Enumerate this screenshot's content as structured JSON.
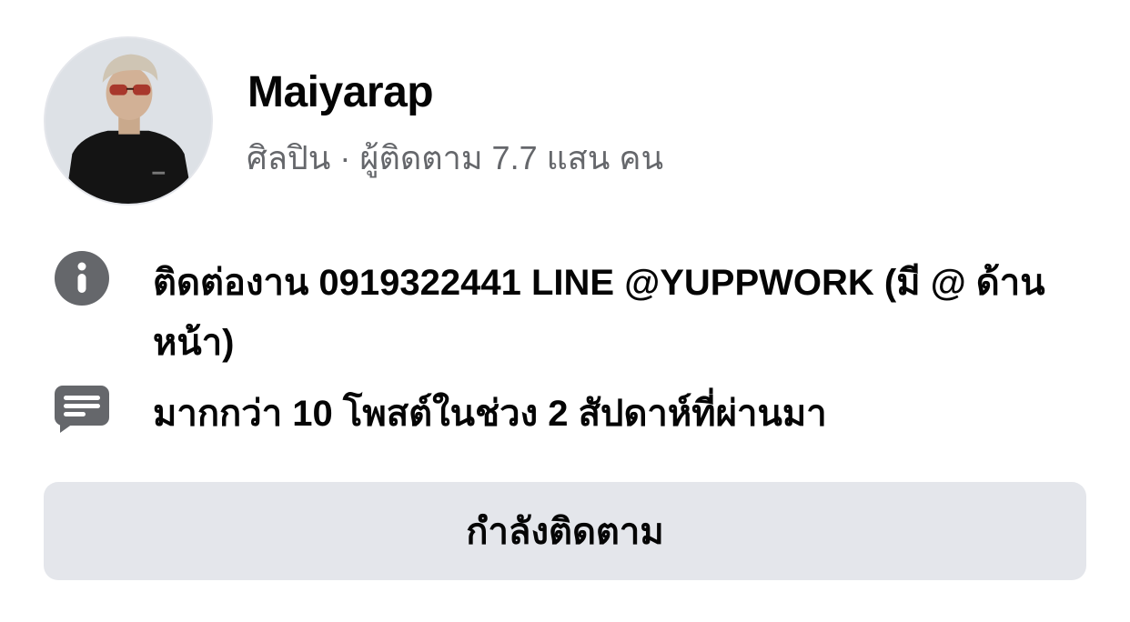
{
  "profile": {
    "name": "Maiyarap",
    "category": "ศิลปิน",
    "separator": " · ",
    "followers": "ผู้ติดตาม 7.7 แสน คน"
  },
  "details": {
    "info_icon": "info-icon",
    "info_text": "ติดต่องาน 0919322441 LINE @YUPPWORK (มี @ ด้านหน้า)",
    "posts_icon": "posts-icon",
    "posts_text": "มากกว่า 10 โพสต์ในช่วง 2 สัปดาห์ที่ผ่านมา"
  },
  "actions": {
    "follow_label": "กำลังติดตาม"
  },
  "colors": {
    "icon_gray": "#65676b",
    "button_bg": "#e4e6eb",
    "text_primary": "#050505",
    "text_secondary": "#65676b"
  }
}
